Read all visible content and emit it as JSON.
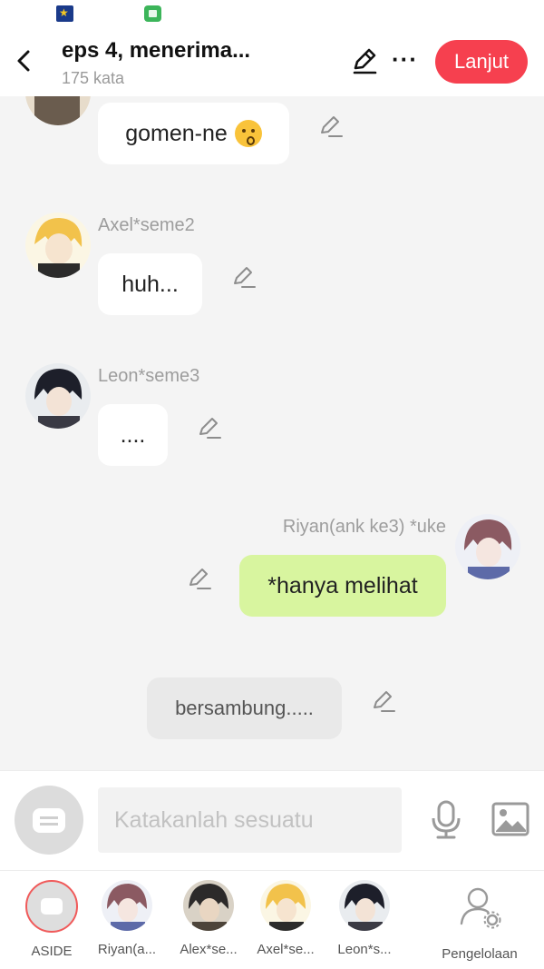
{
  "header": {
    "title": "eps 4, menerima...",
    "subtitle": "175 kata",
    "action_label": "Lanjut"
  },
  "messages": [
    {
      "text": "gomen-ne",
      "emoji": "kissing-face-emoji"
    },
    {
      "speaker": "Axel*seme2",
      "text": "huh..."
    },
    {
      "speaker": "Leon*seme3",
      "text": "...."
    },
    {
      "speaker": "Riyan(ank ke3) *uke",
      "text": "*hanya melihat"
    },
    {
      "text": "bersambung....."
    }
  ],
  "composer": {
    "placeholder": "Katakanlah sesuatu"
  },
  "characters": [
    {
      "label": "ASIDE"
    },
    {
      "label": "Riyan(a..."
    },
    {
      "label": "Alex*se..."
    },
    {
      "label": "Axel*se..."
    },
    {
      "label": "Leon*s..."
    },
    {
      "label": "Pengelolaan"
    }
  ],
  "colors": {
    "accent": "#f6404f",
    "own_bubble": "#d8f59f",
    "background": "#f4f4f4"
  }
}
